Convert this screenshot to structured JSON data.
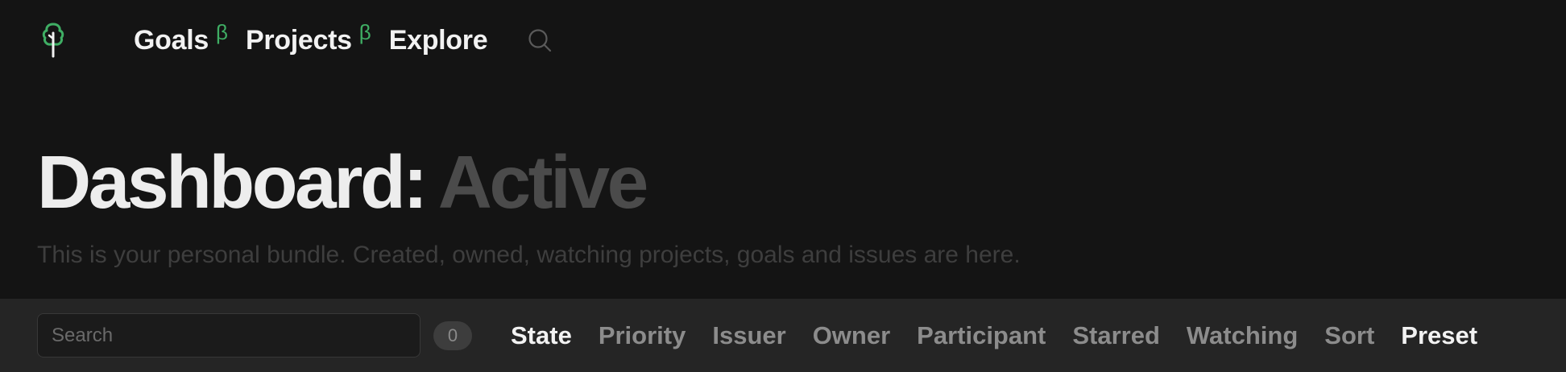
{
  "header": {
    "logo_icon": "tree-icon",
    "nav": [
      {
        "label": "Goals",
        "badge": "β"
      },
      {
        "label": "Projects",
        "badge": "β"
      },
      {
        "label": "Explore",
        "badge": ""
      }
    ],
    "search_icon": "search-icon"
  },
  "title": {
    "main": "Dashboard:",
    "sub": "Active",
    "description": "This is your personal bundle. Created, owned, watching projects, goals and issues are here."
  },
  "filter_bar": {
    "search_placeholder": "Search",
    "search_value": "",
    "count": "0",
    "filters": [
      {
        "label": "State",
        "active": true
      },
      {
        "label": "Priority",
        "active": false
      },
      {
        "label": "Issuer",
        "active": false
      },
      {
        "label": "Owner",
        "active": false
      },
      {
        "label": "Participant",
        "active": false
      },
      {
        "label": "Starred",
        "active": false
      },
      {
        "label": "Watching",
        "active": false
      },
      {
        "label": "Sort",
        "active": false
      },
      {
        "label": "Preset",
        "active": true
      }
    ]
  },
  "colors": {
    "background": "#141414",
    "filter_bar": "#252525",
    "accent": "#3fae64",
    "text_primary": "#f2f2f2",
    "text_muted": "#8c8c8c"
  }
}
